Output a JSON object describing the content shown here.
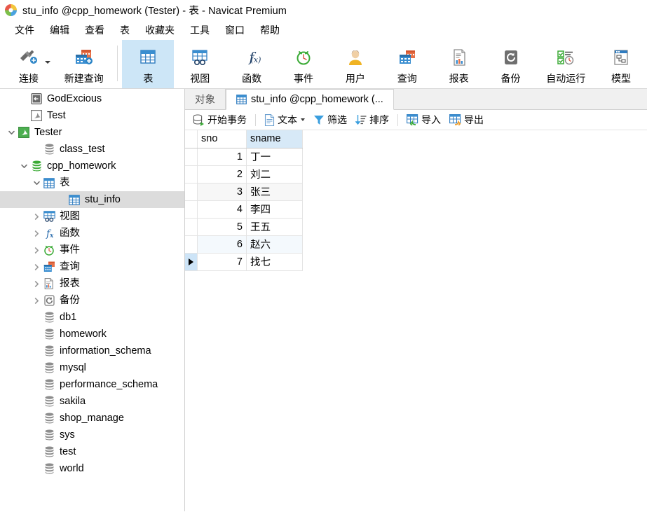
{
  "window": {
    "title": "stu_info @cpp_homework (Tester) - 表 - Navicat Premium",
    "logo_icon": "navicat-logo-icon"
  },
  "menubar": {
    "items": [
      {
        "label": "文件",
        "name": "menu-file"
      },
      {
        "label": "编辑",
        "name": "menu-edit"
      },
      {
        "label": "查看",
        "name": "menu-view"
      },
      {
        "label": "表",
        "name": "menu-table"
      },
      {
        "label": "收藏夹",
        "name": "menu-favorites"
      },
      {
        "label": "工具",
        "name": "menu-tools"
      },
      {
        "label": "窗口",
        "name": "menu-window"
      },
      {
        "label": "帮助",
        "name": "menu-help"
      }
    ]
  },
  "toolbar": {
    "active": "表",
    "buttons": [
      {
        "label": "连接",
        "icon": "connection-icon",
        "has_caret": true
      },
      {
        "label": "新建查询",
        "icon": "new-query-icon",
        "has_caret": false
      },
      {
        "label": "表",
        "icon": "table-icon",
        "has_caret": false
      },
      {
        "label": "视图",
        "icon": "view-icon",
        "has_caret": false
      },
      {
        "label": "函数",
        "icon": "function-icon",
        "has_caret": false
      },
      {
        "label": "事件",
        "icon": "event-clock-icon",
        "has_caret": false
      },
      {
        "label": "用户",
        "icon": "user-icon",
        "has_caret": false
      },
      {
        "label": "查询",
        "icon": "query-icon",
        "has_caret": false
      },
      {
        "label": "报表",
        "icon": "report-icon",
        "has_caret": false
      },
      {
        "label": "备份",
        "icon": "backup-icon",
        "has_caret": false
      },
      {
        "label": "自动运行",
        "icon": "automation-icon",
        "has_caret": false
      },
      {
        "label": "模型",
        "icon": "model-icon",
        "has_caret": false
      }
    ]
  },
  "sidebar": {
    "items": [
      {
        "label": "GodExcious",
        "icon": "connection-gray-icon",
        "indent": 1,
        "twisty": "none",
        "selected": false
      },
      {
        "label": "Test",
        "icon": "mysql-gray-icon",
        "indent": 1,
        "twisty": "none",
        "selected": false
      },
      {
        "label": "Tester",
        "icon": "mysql-green-icon",
        "indent": 0,
        "twisty": "expanded",
        "selected": false
      },
      {
        "label": "class_test",
        "icon": "database-gray-icon",
        "indent": 2,
        "twisty": "none",
        "selected": false
      },
      {
        "label": "cpp_homework",
        "icon": "database-green-icon",
        "indent": 1,
        "twisty": "expanded",
        "selected": false
      },
      {
        "label": "表",
        "icon": "table-folder-icon",
        "indent": 2,
        "twisty": "expanded",
        "selected": false
      },
      {
        "label": "stu_info",
        "icon": "table-icon",
        "indent": 4,
        "twisty": "none",
        "selected": true
      },
      {
        "label": "视图",
        "icon": "view-icon",
        "indent": 2,
        "twisty": "collapsed",
        "selected": false
      },
      {
        "label": "函数",
        "icon": "function-icon",
        "indent": 2,
        "twisty": "collapsed",
        "selected": false
      },
      {
        "label": "事件",
        "icon": "event-clock-icon",
        "indent": 2,
        "twisty": "collapsed",
        "selected": false
      },
      {
        "label": "查询",
        "icon": "query-icon",
        "indent": 2,
        "twisty": "collapsed",
        "selected": false
      },
      {
        "label": "报表",
        "icon": "report-icon",
        "indent": 2,
        "twisty": "collapsed",
        "selected": false
      },
      {
        "label": "备份",
        "icon": "backup-icon",
        "indent": 2,
        "twisty": "collapsed",
        "selected": false
      },
      {
        "label": "db1",
        "icon": "database-gray-icon",
        "indent": 2,
        "twisty": "none",
        "selected": false
      },
      {
        "label": "homework",
        "icon": "database-gray-icon",
        "indent": 2,
        "twisty": "none",
        "selected": false
      },
      {
        "label": "information_schema",
        "icon": "database-gray-icon",
        "indent": 2,
        "twisty": "none",
        "selected": false
      },
      {
        "label": "mysql",
        "icon": "database-gray-icon",
        "indent": 2,
        "twisty": "none",
        "selected": false
      },
      {
        "label": "performance_schema",
        "icon": "database-gray-icon",
        "indent": 2,
        "twisty": "none",
        "selected": false
      },
      {
        "label": "sakila",
        "icon": "database-gray-icon",
        "indent": 2,
        "twisty": "none",
        "selected": false
      },
      {
        "label": "shop_manage",
        "icon": "database-gray-icon",
        "indent": 2,
        "twisty": "none",
        "selected": false
      },
      {
        "label": "sys",
        "icon": "database-gray-icon",
        "indent": 2,
        "twisty": "none",
        "selected": false
      },
      {
        "label": "test",
        "icon": "database-gray-icon",
        "indent": 2,
        "twisty": "none",
        "selected": false
      },
      {
        "label": "world",
        "icon": "database-gray-icon",
        "indent": 2,
        "twisty": "none",
        "selected": false
      }
    ]
  },
  "tabs": {
    "items": [
      {
        "label": "对象",
        "icon": null,
        "active": false,
        "name": "tab-objects"
      },
      {
        "label": "stu_info @cpp_homework (...",
        "icon": "table-icon",
        "active": true,
        "name": "tab-stu-info"
      }
    ]
  },
  "gridbar": {
    "buttons": [
      {
        "label": "开始事务",
        "icon": "begin-transaction-icon",
        "caret": false
      },
      {
        "label": "文本",
        "icon": "text-document-icon",
        "caret": true
      },
      {
        "label": "筛选",
        "icon": "filter-icon",
        "caret": false
      },
      {
        "label": "排序",
        "icon": "sort-icon",
        "caret": false
      },
      {
        "label": "导入",
        "icon": "import-icon",
        "caret": false
      },
      {
        "label": "导出",
        "icon": "export-icon",
        "caret": false
      }
    ]
  },
  "grid": {
    "columns": [
      {
        "label": "sno",
        "selected": false
      },
      {
        "label": "sname",
        "selected": true
      }
    ],
    "rows": [
      {
        "sno": "1",
        "sname": "丁一",
        "current": false
      },
      {
        "sno": "2",
        "sname": "刘二",
        "current": false
      },
      {
        "sno": "3",
        "sname": "张三",
        "current": false
      },
      {
        "sno": "4",
        "sname": "李四",
        "current": false
      },
      {
        "sno": "5",
        "sname": "王五",
        "current": false
      },
      {
        "sno": "6",
        "sname": "赵六",
        "current": false
      },
      {
        "sno": "7",
        "sname": "找七",
        "current": true
      }
    ]
  },
  "colors": {
    "accent": "#3a78b8",
    "selection": "#cde6f7",
    "tree_selection": "#dcdcdc",
    "column_selected": "#d7e9f7",
    "green": "#4caf50",
    "orange": "#e8734a"
  }
}
